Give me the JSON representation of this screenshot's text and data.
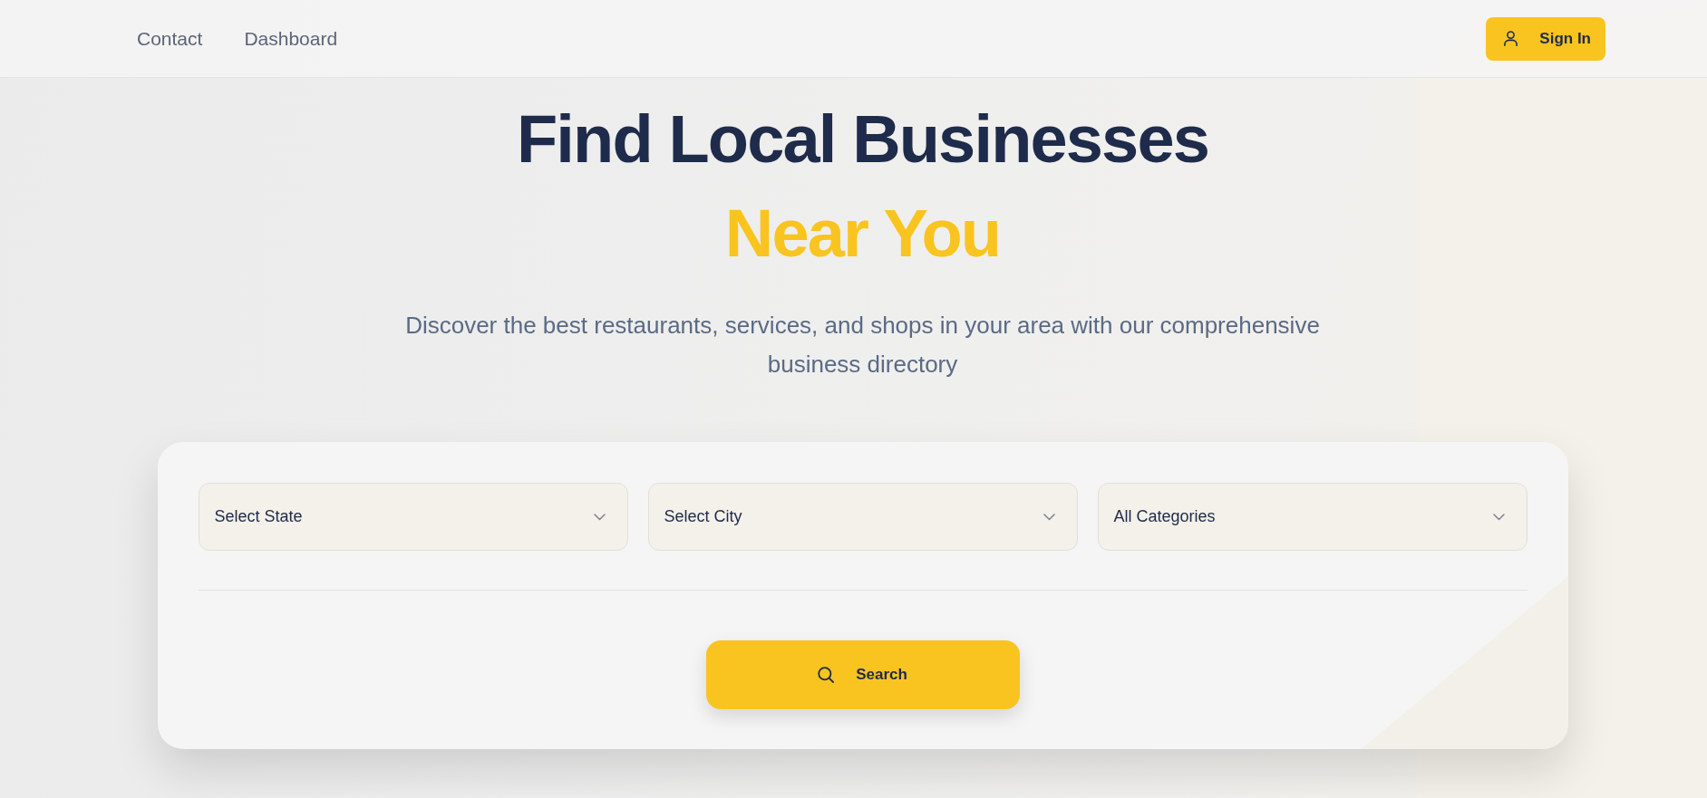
{
  "nav": {
    "links": [
      {
        "label": "Contact"
      },
      {
        "label": "Dashboard"
      }
    ],
    "sign_in_button": {
      "label": "Sign In"
    }
  },
  "hero": {
    "title": "Find Local Businesses",
    "title_highlight": "Near You",
    "subtitle": "Discover the best restaurants, services, and shops in your area with our comprehensive business directory"
  },
  "search_card": {
    "selects": [
      {
        "value": "Select State"
      },
      {
        "value": "Select City"
      },
      {
        "value": "All Categories"
      }
    ],
    "search_button": {
      "label": "Search"
    }
  }
}
